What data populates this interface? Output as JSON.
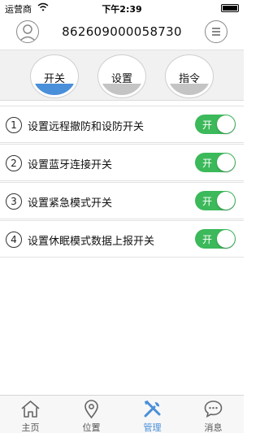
{
  "status_bar": {
    "carrier": "运营商",
    "time": "下午2:39"
  },
  "header": {
    "title": "862609000058730"
  },
  "tabs": [
    {
      "label": "开关",
      "active": true
    },
    {
      "label": "设置",
      "active": false
    },
    {
      "label": "指令",
      "active": false
    }
  ],
  "settings": [
    {
      "num": "1",
      "label": "设置远程撤防和设防开关",
      "toggle": "开"
    },
    {
      "num": "2",
      "label": "设置蓝牙连接开关",
      "toggle": "开"
    },
    {
      "num": "3",
      "label": "设置紧急模式开关",
      "toggle": "开"
    },
    {
      "num": "4",
      "label": "设置休眠模式数据上报开关",
      "toggle": "开"
    }
  ],
  "bottom_nav": [
    {
      "label": "主页",
      "icon": "home-icon",
      "active": false
    },
    {
      "label": "位置",
      "icon": "location-pin-icon",
      "active": false
    },
    {
      "label": "管理",
      "icon": "tools-icon",
      "active": true
    },
    {
      "label": "消息",
      "icon": "chat-bubble-icon",
      "active": false
    }
  ],
  "colors": {
    "accent": "#4a8fd9",
    "toggle_on": "#3cb95a",
    "tab_inactive_fill": "#c4c4c4",
    "nav_inactive": "#666666"
  }
}
